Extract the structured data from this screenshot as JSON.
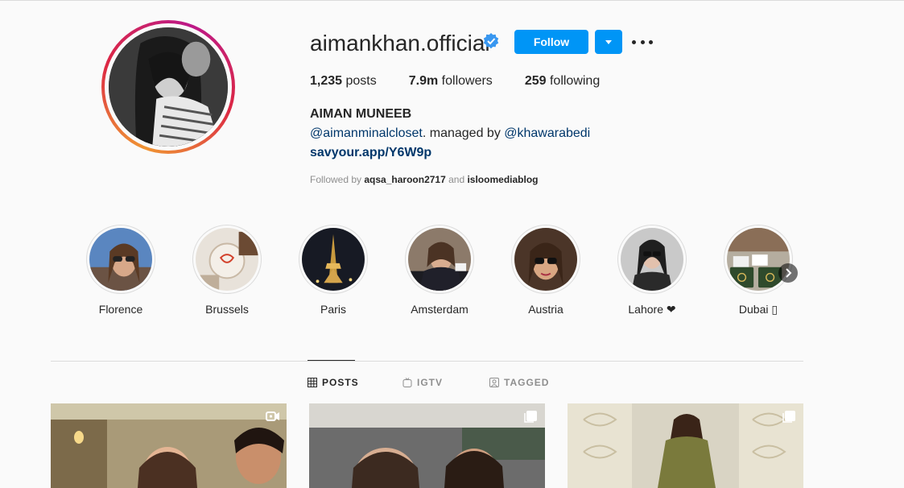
{
  "profile": {
    "username": "aimankhan.official",
    "verified_icon": "verified-badge-icon",
    "follow_label": "Follow",
    "stats": {
      "posts_count": "1,235",
      "posts_label": "posts",
      "followers_count": "7.9m",
      "followers_label": "followers",
      "following_count": "259",
      "following_label": "following"
    },
    "full_name": "AIMAN MUNEEB",
    "bio": {
      "mention1": "@aimanminalcloset",
      "text": ". managed by ",
      "mention2": "@khawarabedi"
    },
    "link": "savyour.app/Y6W9p",
    "followed_by": {
      "prefix": "Followed by ",
      "user1": "aqsa_haroon2717",
      "and": " and ",
      "user2": "isloomediablog"
    }
  },
  "highlights": [
    {
      "label": "Florence"
    },
    {
      "label": "Brussels"
    },
    {
      "label": "Paris"
    },
    {
      "label": "Amsterdam"
    },
    {
      "label": "Austria"
    },
    {
      "label": "Lahore ❤"
    },
    {
      "label": "Dubai ▯"
    }
  ],
  "tabs": [
    {
      "label": "POSTS",
      "icon": "grid-icon",
      "active": true
    },
    {
      "label": "IGTV",
      "icon": "igtv-icon",
      "active": false
    },
    {
      "label": "TAGGED",
      "icon": "tagged-icon",
      "active": false
    }
  ],
  "posts": [
    {
      "badge": "video-icon"
    },
    {
      "badge": "carousel-icon"
    },
    {
      "badge": "carousel-icon"
    }
  ],
  "colors": {
    "accent": "#0095f6",
    "link": "#00376b",
    "text": "#262626",
    "muted": "#8e8e8e",
    "background": "#fafafa"
  }
}
